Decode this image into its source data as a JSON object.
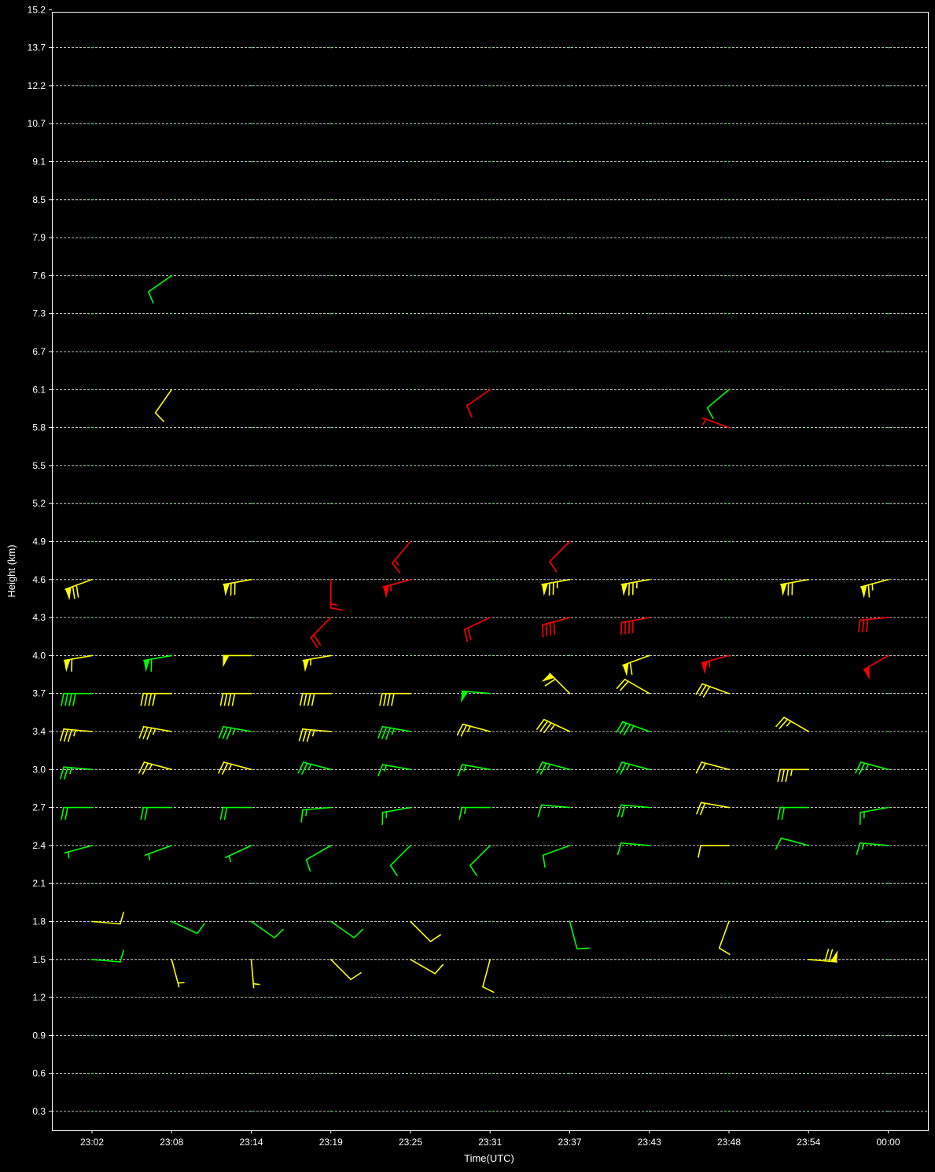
{
  "chart_data": {
    "type": "wind-barb",
    "xlabel": "Time(UTC)",
    "ylabel": "Height (km)",
    "x_ticks": [
      "23:02",
      "23:08",
      "23:14",
      "23:19",
      "23:25",
      "23:31",
      "23:37",
      "23:43",
      "23:48",
      "23:54",
      "00:00"
    ],
    "y_ticks": [
      "0.3",
      "0.6",
      "0.9",
      "1.2",
      "1.5",
      "1.8",
      "2.1",
      "2.4",
      "2.7",
      "3.0",
      "3.4",
      "3.7",
      "4.0",
      "4.3",
      "4.6",
      "4.9",
      "5.2",
      "5.5",
      "5.8",
      "6.1",
      "6.7",
      "7.3",
      "7.6",
      "7.9",
      "8.5",
      "9.1",
      "10.7",
      "12.2",
      "13.7",
      "15.2"
    ],
    "grid": "horizontal-dashed",
    "colors": {
      "background": "#000000",
      "grid": "#ffffff",
      "green": "#00ff00",
      "yellow": "#ffff00",
      "red": "#ff0000"
    },
    "barbs": [
      {
        "time": "23:08",
        "height": "7.6",
        "dir": 235,
        "speed": 10,
        "color": "green"
      },
      {
        "time": "23:08",
        "height": "6.1",
        "dir": 215,
        "speed": 10,
        "color": "yellow"
      },
      {
        "time": "23:31",
        "height": "6.1",
        "dir": 235,
        "speed": 10,
        "color": "red"
      },
      {
        "time": "23:48",
        "height": "6.1",
        "dir": 230,
        "speed": 10,
        "color": "green"
      },
      {
        "time": "23:48",
        "height": "5.8",
        "dir": 290,
        "speed": 5,
        "color": "red"
      },
      {
        "time": "23:25",
        "height": "4.9",
        "dir": 220,
        "speed": 15,
        "color": "red"
      },
      {
        "time": "23:37",
        "height": "4.9",
        "dir": 225,
        "speed": 10,
        "color": "red"
      },
      {
        "time": "23:19",
        "height": "4.6",
        "dir": 180,
        "speed": 15,
        "color": "red"
      },
      {
        "time": "23:02",
        "height": "4.6",
        "dir": 250,
        "speed": 70,
        "color": "yellow"
      },
      {
        "time": "23:14",
        "height": "4.6",
        "dir": 260,
        "speed": 70,
        "color": "yellow"
      },
      {
        "time": "23:25",
        "height": "4.6",
        "dir": 255,
        "speed": 55,
        "color": "red"
      },
      {
        "time": "23:37",
        "height": "4.6",
        "dir": 260,
        "speed": 75,
        "color": "yellow"
      },
      {
        "time": "23:43",
        "height": "4.6",
        "dir": 260,
        "speed": 75,
        "color": "yellow"
      },
      {
        "time": "23:54",
        "height": "4.6",
        "dir": 260,
        "speed": 70,
        "color": "yellow"
      },
      {
        "time": "00:00",
        "height": "4.6",
        "dir": 255,
        "speed": 65,
        "color": "yellow"
      },
      {
        "time": "23:19",
        "height": "4.3",
        "dir": 225,
        "speed": 20,
        "color": "red"
      },
      {
        "time": "23:31",
        "height": "4.3",
        "dir": 245,
        "speed": 20,
        "color": "red"
      },
      {
        "time": "23:37",
        "height": "4.3",
        "dir": 255,
        "speed": 40,
        "color": "red"
      },
      {
        "time": "23:43",
        "height": "4.3",
        "dir": 260,
        "speed": 40,
        "color": "red"
      },
      {
        "time": "00:00",
        "height": "4.3",
        "dir": 265,
        "speed": 30,
        "color": "red"
      },
      {
        "time": "23:02",
        "height": "4.0",
        "dir": 260,
        "speed": 60,
        "color": "yellow"
      },
      {
        "time": "23:08",
        "height": "4.0",
        "dir": 260,
        "speed": 60,
        "color": "green"
      },
      {
        "time": "23:14",
        "height": "4.0",
        "dir": 270,
        "speed": 50,
        "color": "yellow"
      },
      {
        "time": "23:19",
        "height": "4.0",
        "dir": 260,
        "speed": 55,
        "color": "yellow"
      },
      {
        "time": "23:43",
        "height": "4.0",
        "dir": 250,
        "speed": 60,
        "color": "yellow"
      },
      {
        "time": "23:48",
        "height": "4.0",
        "dir": 255,
        "speed": 55,
        "color": "red"
      },
      {
        "time": "00:00",
        "height": "4.0",
        "dir": 240,
        "speed": 50,
        "color": "red"
      },
      {
        "time": "23:02",
        "height": "3.7",
        "dir": 270,
        "speed": 40,
        "color": "green"
      },
      {
        "time": "23:08",
        "height": "3.7",
        "dir": 270,
        "speed": 40,
        "color": "yellow"
      },
      {
        "time": "23:14",
        "height": "3.7",
        "dir": 270,
        "speed": 40,
        "color": "yellow"
      },
      {
        "time": "23:19",
        "height": "3.7",
        "dir": 270,
        "speed": 40,
        "color": "yellow"
      },
      {
        "time": "23:25",
        "height": "3.7",
        "dir": 270,
        "speed": 40,
        "color": "yellow"
      },
      {
        "time": "23:31",
        "height": "3.7",
        "dir": 275,
        "speed": 50,
        "color": "green"
      },
      {
        "time": "23:37",
        "height": "3.7",
        "dir": 315,
        "speed": 60,
        "color": "yellow"
      },
      {
        "time": "23:43",
        "height": "3.7",
        "dir": 300,
        "speed": 20,
        "color": "yellow"
      },
      {
        "time": "23:48",
        "height": "3.7",
        "dir": 290,
        "speed": 30,
        "color": "yellow"
      },
      {
        "time": "23:02",
        "height": "3.4",
        "dir": 275,
        "speed": 35,
        "color": "yellow"
      },
      {
        "time": "23:08",
        "height": "3.4",
        "dir": 280,
        "speed": 35,
        "color": "yellow"
      },
      {
        "time": "23:14",
        "height": "3.4",
        "dir": 280,
        "speed": 35,
        "color": "green"
      },
      {
        "time": "23:19",
        "height": "3.4",
        "dir": 275,
        "speed": 35,
        "color": "yellow"
      },
      {
        "time": "23:25",
        "height": "3.4",
        "dir": 280,
        "speed": 35,
        "color": "green"
      },
      {
        "time": "23:31",
        "height": "3.4",
        "dir": 285,
        "speed": 25,
        "color": "yellow"
      },
      {
        "time": "23:37",
        "height": "3.4",
        "dir": 295,
        "speed": 35,
        "color": "yellow"
      },
      {
        "time": "23:43",
        "height": "3.4",
        "dir": 290,
        "speed": 35,
        "color": "green"
      },
      {
        "time": "23:54",
        "height": "3.4",
        "dir": 300,
        "speed": 25,
        "color": "yellow"
      },
      {
        "time": "23:02",
        "height": "3.0",
        "dir": 275,
        "speed": 25,
        "color": "green"
      },
      {
        "time": "23:08",
        "height": "3.0",
        "dir": 285,
        "speed": 25,
        "color": "yellow"
      },
      {
        "time": "23:14",
        "height": "3.0",
        "dir": 285,
        "speed": 25,
        "color": "yellow"
      },
      {
        "time": "23:19",
        "height": "3.0",
        "dir": 285,
        "speed": 25,
        "color": "green"
      },
      {
        "time": "23:25",
        "height": "3.0",
        "dir": 280,
        "speed": 15,
        "color": "green"
      },
      {
        "time": "23:31",
        "height": "3.0",
        "dir": 280,
        "speed": 15,
        "color": "green"
      },
      {
        "time": "23:37",
        "height": "3.0",
        "dir": 285,
        "speed": 25,
        "color": "green"
      },
      {
        "time": "23:43",
        "height": "3.0",
        "dir": 285,
        "speed": 25,
        "color": "green"
      },
      {
        "time": "23:48",
        "height": "3.0",
        "dir": 285,
        "speed": 15,
        "color": "yellow"
      },
      {
        "time": "23:54",
        "height": "3.0",
        "dir": 270,
        "speed": 35,
        "color": "yellow"
      },
      {
        "time": "00:00",
        "height": "3.0",
        "dir": 285,
        "speed": 25,
        "color": "green"
      },
      {
        "time": "23:02",
        "height": "2.7",
        "dir": 270,
        "speed": 20,
        "color": "green"
      },
      {
        "time": "23:08",
        "height": "2.7",
        "dir": 270,
        "speed": 20,
        "color": "green"
      },
      {
        "time": "23:14",
        "height": "2.7",
        "dir": 270,
        "speed": 20,
        "color": "green"
      },
      {
        "time": "23:19",
        "height": "2.7",
        "dir": 265,
        "speed": 15,
        "color": "green"
      },
      {
        "time": "23:25",
        "height": "2.7",
        "dir": 260,
        "speed": 15,
        "color": "green"
      },
      {
        "time": "23:31",
        "height": "2.7",
        "dir": 270,
        "speed": 15,
        "color": "green"
      },
      {
        "time": "23:37",
        "height": "2.7",
        "dir": 275,
        "speed": 10,
        "color": "green"
      },
      {
        "time": "23:43",
        "height": "2.7",
        "dir": 275,
        "speed": 20,
        "color": "green"
      },
      {
        "time": "23:48",
        "height": "2.7",
        "dir": 280,
        "speed": 20,
        "color": "yellow"
      },
      {
        "time": "23:54",
        "height": "2.7",
        "dir": 270,
        "speed": 20,
        "color": "green"
      },
      {
        "time": "00:00",
        "height": "2.7",
        "dir": 260,
        "speed": 15,
        "color": "green"
      },
      {
        "time": "23:02",
        "height": "2.4",
        "dir": 255,
        "speed": 5,
        "color": "green"
      },
      {
        "time": "23:08",
        "height": "2.4",
        "dir": 250,
        "speed": 5,
        "color": "green"
      },
      {
        "time": "23:14",
        "height": "2.4",
        "dir": 245,
        "speed": 5,
        "color": "green"
      },
      {
        "time": "23:19",
        "height": "2.4",
        "dir": 240,
        "speed": 10,
        "color": "green"
      },
      {
        "time": "23:25",
        "height": "2.4",
        "dir": 225,
        "speed": 10,
        "color": "green"
      },
      {
        "time": "23:31",
        "height": "2.4",
        "dir": 225,
        "speed": 10,
        "color": "green"
      },
      {
        "time": "23:37",
        "height": "2.4",
        "dir": 250,
        "speed": 10,
        "color": "green"
      },
      {
        "time": "23:43",
        "height": "2.4",
        "dir": 275,
        "speed": 10,
        "color": "green"
      },
      {
        "time": "23:48",
        "height": "2.4",
        "dir": 270,
        "speed": 10,
        "color": "yellow"
      },
      {
        "time": "23:54",
        "height": "2.4",
        "dir": 285,
        "speed": 10,
        "color": "green"
      },
      {
        "time": "00:00",
        "height": "2.4",
        "dir": 275,
        "speed": 15,
        "color": "green"
      },
      {
        "time": "23:02",
        "height": "1.8",
        "dir": 95,
        "speed": 10,
        "color": "yellow"
      },
      {
        "time": "23:08",
        "height": "1.8",
        "dir": 115,
        "speed": 10,
        "color": "green"
      },
      {
        "time": "23:14",
        "height": "1.8",
        "dir": 125,
        "speed": 10,
        "color": "green"
      },
      {
        "time": "23:19",
        "height": "1.8",
        "dir": 125,
        "speed": 10,
        "color": "green"
      },
      {
        "time": "23:25",
        "height": "1.8",
        "dir": 135,
        "speed": 10,
        "color": "yellow"
      },
      {
        "time": "23:37",
        "height": "1.8",
        "dir": 165,
        "speed": 10,
        "color": "green"
      },
      {
        "time": "23:48",
        "height": "1.8",
        "dir": 200,
        "speed": 10,
        "color": "yellow"
      },
      {
        "time": "23:02",
        "height": "1.5",
        "dir": 95,
        "speed": 10,
        "color": "green"
      },
      {
        "time": "23:08",
        "height": "1.5",
        "dir": 165,
        "speed": 5,
        "color": "yellow"
      },
      {
        "time": "23:14",
        "height": "1.5",
        "dir": 175,
        "speed": 5,
        "color": "yellow"
      },
      {
        "time": "23:19",
        "height": "1.5",
        "dir": 135,
        "speed": 10,
        "color": "yellow"
      },
      {
        "time": "23:25",
        "height": "1.5",
        "dir": 120,
        "speed": 10,
        "color": "yellow"
      },
      {
        "time": "23:31",
        "height": "1.5",
        "dir": 195,
        "speed": 10,
        "color": "yellow"
      },
      {
        "time": "23:54",
        "height": "1.5",
        "dir": 95,
        "speed": 70,
        "color": "yellow"
      }
    ]
  }
}
